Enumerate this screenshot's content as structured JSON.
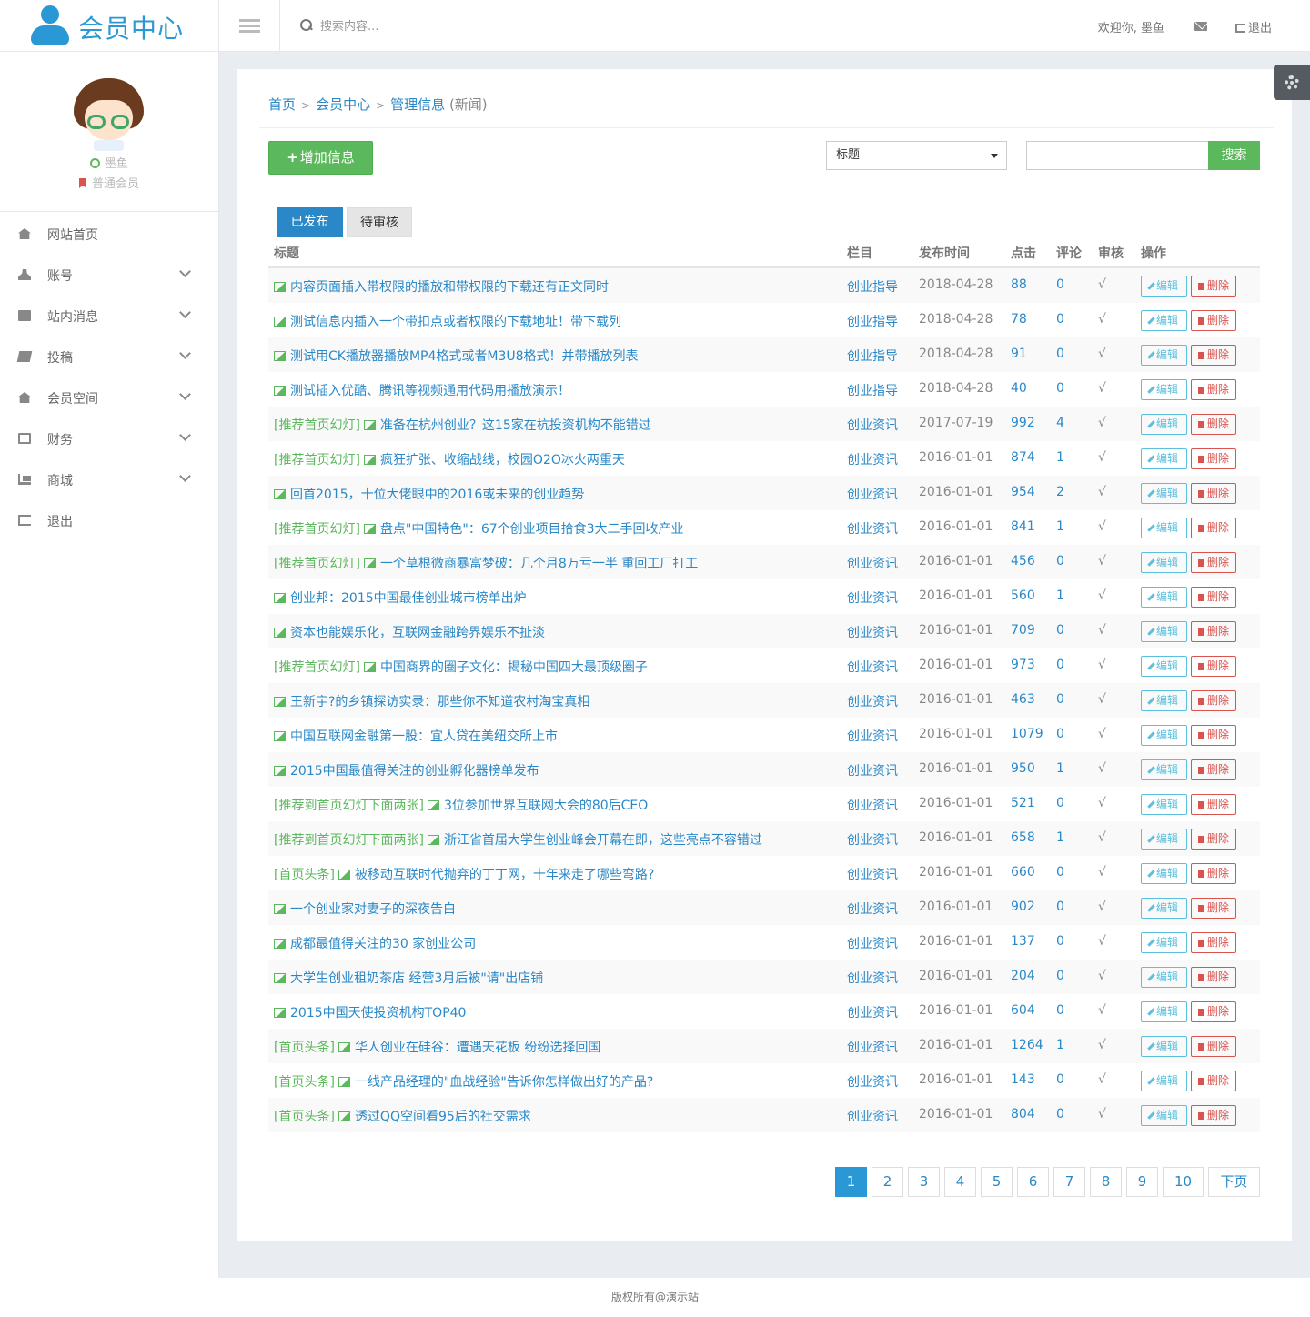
{
  "header": {
    "app_title": "会员中心",
    "search_placeholder": "搜索内容...",
    "welcome": "欢迎你, 墨鱼",
    "logout": "退出"
  },
  "profile": {
    "username": "墨鱼",
    "level": "普通会员"
  },
  "sidebar": {
    "items": [
      {
        "label": "网站首页",
        "icon": "home-icon"
      },
      {
        "label": "账号",
        "icon": "user-icon"
      },
      {
        "label": "站内消息",
        "icon": "envelope-icon"
      },
      {
        "label": "投稿",
        "icon": "book-icon"
      },
      {
        "label": "会员空间",
        "icon": "home-icon"
      },
      {
        "label": "财务",
        "icon": "money-icon"
      },
      {
        "label": "商城",
        "icon": "cart-icon"
      },
      {
        "label": "退出",
        "icon": "sign-out-icon"
      }
    ]
  },
  "breadcrumb": {
    "home": "首页",
    "member": "会员中心",
    "manage": "管理信息",
    "suffix": "(新闻)",
    "sep": ">"
  },
  "toolbar": {
    "add_label": "增加信息",
    "field_select": "标题",
    "search_button": "搜索"
  },
  "tabs": {
    "published": "已发布",
    "pending": "待审核"
  },
  "table": {
    "headers": {
      "title": "标题",
      "category": "栏目",
      "date": "发布时间",
      "hits": "点击",
      "comments": "评论",
      "review": "审核",
      "actions": "操作"
    },
    "edit_label": "编辑",
    "delete_label": "删除",
    "rows": [
      {
        "tag": "",
        "title": "内容页面插入带权限的播放和带权限的下载还有正文同时",
        "category": "创业指导",
        "date": "2018-04-28",
        "hits": "88",
        "comments": "0",
        "review": "√"
      },
      {
        "tag": "",
        "title": "测试信息内插入一个带扣点或者权限的下载地址！带下载列",
        "category": "创业指导",
        "date": "2018-04-28",
        "hits": "78",
        "comments": "0",
        "review": "√"
      },
      {
        "tag": "",
        "title": "测试用CK播放器播放MP4格式或者M3U8格式！并带播放列表",
        "category": "创业指导",
        "date": "2018-04-28",
        "hits": "91",
        "comments": "0",
        "review": "√"
      },
      {
        "tag": "",
        "title": "测试插入优酷、腾讯等视频通用代码用播放演示！",
        "category": "创业指导",
        "date": "2018-04-28",
        "hits": "40",
        "comments": "0",
        "review": "√"
      },
      {
        "tag": "[推荐首页幻灯]",
        "title": "准备在杭州创业？这15家在杭投资机构不能错过",
        "category": "创业资讯",
        "date": "2017-07-19",
        "hits": "992",
        "comments": "4",
        "review": "√"
      },
      {
        "tag": "[推荐首页幻灯]",
        "title": "疯狂扩张、收缩战线，校园O2O冰火两重天",
        "category": "创业资讯",
        "date": "2016-01-01",
        "hits": "874",
        "comments": "1",
        "review": "√"
      },
      {
        "tag": "",
        "title": "回首2015，十位大佬眼中的2016或未来的创业趋势",
        "category": "创业资讯",
        "date": "2016-01-01",
        "hits": "954",
        "comments": "2",
        "review": "√"
      },
      {
        "tag": "[推荐首页幻灯]",
        "title": "盘点\"中国特色\"：67个创业项目拾食3大二手回收产业",
        "category": "创业资讯",
        "date": "2016-01-01",
        "hits": "841",
        "comments": "1",
        "review": "√"
      },
      {
        "tag": "[推荐首页幻灯]",
        "title": "一个草根微商暴富梦破：几个月8万亏一半 重回工厂打工",
        "category": "创业资讯",
        "date": "2016-01-01",
        "hits": "456",
        "comments": "0",
        "review": "√"
      },
      {
        "tag": "",
        "title": "创业邦：2015中国最佳创业城市榜单出炉",
        "category": "创业资讯",
        "date": "2016-01-01",
        "hits": "560",
        "comments": "1",
        "review": "√"
      },
      {
        "tag": "",
        "title": "资本也能娱乐化，互联网金融跨界娱乐不扯淡",
        "category": "创业资讯",
        "date": "2016-01-01",
        "hits": "709",
        "comments": "0",
        "review": "√"
      },
      {
        "tag": "[推荐首页幻灯]",
        "title": "中国商界的圈子文化：揭秘中国四大最顶级圈子",
        "category": "创业资讯",
        "date": "2016-01-01",
        "hits": "973",
        "comments": "0",
        "review": "√"
      },
      {
        "tag": "",
        "title": "王新宇?的乡镇探访实录：那些你不知道农村淘宝真相",
        "category": "创业资讯",
        "date": "2016-01-01",
        "hits": "463",
        "comments": "0",
        "review": "√"
      },
      {
        "tag": "",
        "title": "中国互联网金融第一股：宜人贷在美纽交所上市",
        "category": "创业资讯",
        "date": "2016-01-01",
        "hits": "1079",
        "comments": "0",
        "review": "√"
      },
      {
        "tag": "",
        "title": "2015中国最值得关注的创业孵化器榜单发布",
        "category": "创业资讯",
        "date": "2016-01-01",
        "hits": "950",
        "comments": "1",
        "review": "√"
      },
      {
        "tag": "[推荐到首页幻灯下面两张]",
        "title": "3位参加世界互联网大会的80后CEO",
        "category": "创业资讯",
        "date": "2016-01-01",
        "hits": "521",
        "comments": "0",
        "review": "√"
      },
      {
        "tag": "[推荐到首页幻灯下面两张]",
        "title": "浙江省首届大学生创业峰会开幕在即，这些亮点不容错过",
        "category": "创业资讯",
        "date": "2016-01-01",
        "hits": "658",
        "comments": "1",
        "review": "√"
      },
      {
        "tag": "[首页头条]",
        "title": "被移动互联时代抛弃的丁丁网，十年来走了哪些弯路?",
        "category": "创业资讯",
        "date": "2016-01-01",
        "hits": "660",
        "comments": "0",
        "review": "√"
      },
      {
        "tag": "",
        "title": "一个创业家对妻子的深夜告白",
        "category": "创业资讯",
        "date": "2016-01-01",
        "hits": "902",
        "comments": "0",
        "review": "√"
      },
      {
        "tag": "",
        "title": "成都最值得关注的30 家创业公司",
        "category": "创业资讯",
        "date": "2016-01-01",
        "hits": "137",
        "comments": "0",
        "review": "√"
      },
      {
        "tag": "",
        "title": "大学生创业租奶茶店 经营3月后被\"请\"出店铺",
        "category": "创业资讯",
        "date": "2016-01-01",
        "hits": "204",
        "comments": "0",
        "review": "√"
      },
      {
        "tag": "",
        "title": "2015中国天使投资机构TOP40",
        "category": "创业资讯",
        "date": "2016-01-01",
        "hits": "604",
        "comments": "0",
        "review": "√"
      },
      {
        "tag": "[首页头条]",
        "title": "华人创业在硅谷：遭遇天花板 纷纷选择回国",
        "category": "创业资讯",
        "date": "2016-01-01",
        "hits": "1264",
        "comments": "1",
        "review": "√"
      },
      {
        "tag": "[首页头条]",
        "title": "一线产品经理的\"血战经验\"告诉你怎样做出好的产品?",
        "category": "创业资讯",
        "date": "2016-01-01",
        "hits": "143",
        "comments": "0",
        "review": "√"
      },
      {
        "tag": "[首页头条]",
        "title": "透过QQ空间看95后的社交需求",
        "category": "创业资讯",
        "date": "2016-01-01",
        "hits": "804",
        "comments": "0",
        "review": "√"
      }
    ]
  },
  "pagination": {
    "pages": [
      "1",
      "2",
      "3",
      "4",
      "5",
      "6",
      "7",
      "8",
      "9",
      "10"
    ],
    "current": "1",
    "next": "下页"
  },
  "footer": {
    "copyright": "版权所有@演示站"
  },
  "colors": {
    "brand": "#2a98d4",
    "link": "#2a88c8",
    "success": "#5cb85c",
    "danger": "#d9534f",
    "info": "#5bc0de"
  }
}
